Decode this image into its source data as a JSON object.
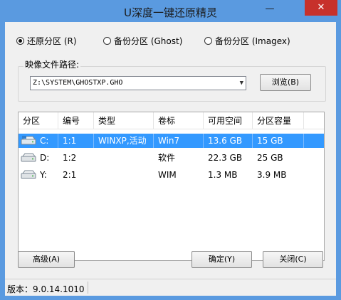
{
  "window": {
    "title": "U深度一键还原精灵",
    "minimize_glyph": "—",
    "close_glyph": "✕"
  },
  "mode": {
    "options": [
      {
        "label": "还原分区 (R)",
        "checked": true
      },
      {
        "label": "备份分区 (Ghost)",
        "checked": false
      },
      {
        "label": "备份分区 (Imagex)",
        "checked": false
      }
    ]
  },
  "image_path": {
    "label": "映像文件路径:",
    "value": "Z:\\SYSTEM\\GHOSTXP.GHO",
    "browse_label": "浏览(B)"
  },
  "table": {
    "headers": [
      "分区",
      "编号",
      "类型",
      "卷标",
      "可用空间",
      "分区容量"
    ],
    "rows": [
      {
        "drive": "C:",
        "num": "1:1",
        "type": "WINXP,活动",
        "label": "Win7",
        "free": "13.6 GB",
        "size": "15 GB",
        "selected": true
      },
      {
        "drive": "D:",
        "num": "1:2",
        "type": "",
        "label": "软件",
        "free": "22.3 GB",
        "size": "25 GB",
        "selected": false
      },
      {
        "drive": "Y:",
        "num": "2:1",
        "type": "",
        "label": "WIM",
        "free": "1.3 MB",
        "size": "3.9 MB",
        "selected": false
      }
    ]
  },
  "buttons": {
    "advanced": "高级(A)",
    "ok": "确定(Y)",
    "close": "关闭(C)"
  },
  "status": {
    "version": "版本：9.0.14.1010"
  },
  "colors": {
    "titlebar": "#5a9ae0",
    "close_button": "#c7312b",
    "selection": "#3399ff"
  }
}
